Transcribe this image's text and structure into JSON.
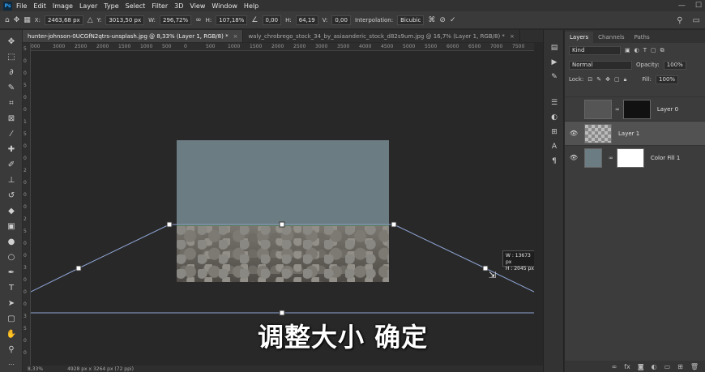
{
  "app": {
    "logo": "Ps",
    "menu": [
      "File",
      "Edit",
      "Image",
      "Layer",
      "Type",
      "Select",
      "Filter",
      "3D",
      "View",
      "Window",
      "Help"
    ]
  },
  "options": {
    "x_label": "X:",
    "x_value": "2463,68 px",
    "y_label": "Y:",
    "y_value": "3013,50 px",
    "w_label": "W:",
    "w_value": "296,72%",
    "h_label": "H:",
    "h_value": "107,18%",
    "angle_value": "0,00",
    "hskew_label": "H:",
    "hskew_value": "64,19",
    "vskew_label": "V:",
    "vskew_value": "0,00",
    "interp_label": "Interpolation:",
    "interp_value": "Bicubic"
  },
  "tabs": [
    {
      "label": "hunter-johnson-0UCGfN2qtrs-unsplash.jpg @ 8,33% (Layer 1, RGB/8) *",
      "active": true
    },
    {
      "label": "waly_chrobrego_stock_34_by_asiaanderic_stock_d82s9um.jpg @ 16,7% (Layer 1, RGB/8) *",
      "active": false
    }
  ],
  "ruler_top": [
    "000",
    "3000",
    "2500",
    "2000",
    "1500",
    "1000",
    "500",
    "0",
    "500",
    "1000",
    "1500",
    "2000",
    "2500",
    "3000",
    "3500",
    "4000",
    "4500",
    "5000",
    "5500",
    "6000",
    "6500",
    "7000",
    "7500"
  ],
  "ruler_left": [
    "5",
    "0",
    "0",
    "5",
    "0",
    "0",
    "1",
    "5",
    "0",
    "0",
    "2",
    "0",
    "0",
    "0",
    "2",
    "5",
    "0",
    "0",
    "3",
    "0",
    "0",
    "0",
    "3",
    "5",
    "0",
    "0"
  ],
  "hud": {
    "w_line": "W :   13673 px",
    "h_line": "H :    2045 px"
  },
  "caption": "调整大小 确定",
  "status": {
    "zoom": "8,33%",
    "doc": "4928 px x 3264 px (72 ppi)"
  },
  "layers": {
    "tabs": [
      "Layers",
      "Channels",
      "Paths"
    ],
    "kind_placeholder": "Kind",
    "blend_mode": "Normal",
    "opacity_label": "Opacity:",
    "opacity_value": "100%",
    "lock_label": "Lock:",
    "fill_label": "Fill:",
    "fill_value": "100%",
    "items": [
      {
        "name": "Layer 0",
        "visible": false
      },
      {
        "name": "Layer 1",
        "visible": true,
        "selected": true
      },
      {
        "name": "Color Fill 1",
        "visible": true
      }
    ]
  },
  "colors": {
    "accent": "#31a8ff",
    "selected_layer": "#525252",
    "fill_color": "#6b7c82"
  }
}
